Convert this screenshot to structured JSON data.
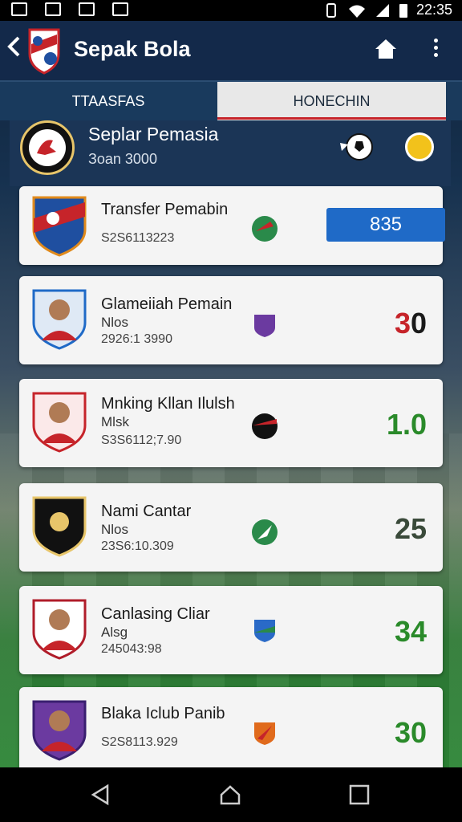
{
  "status_bar": {
    "time": "22:35"
  },
  "app_bar": {
    "title": "Sepak Bola"
  },
  "tabs": [
    {
      "label": "TTAASFAS",
      "active": false
    },
    {
      "label": "HONECHIN",
      "active": true
    }
  ],
  "header": {
    "title": "Seplar Pemasia",
    "subtitle": "Зoan 3000"
  },
  "items": [
    {
      "name": "Transfer Pemabin",
      "sub": "",
      "code": "S2S6113223",
      "score": "835",
      "score_color": "#ffffff",
      "highlight": true
    },
    {
      "name": "Glameiiah Pemain",
      "sub": "Nlos",
      "code": "2926:1 3990",
      "score": "30",
      "score_color": "#1a1a1a",
      "highlight": false
    },
    {
      "name": "Mnking Kllan Ilulsh",
      "sub": "Mlsk",
      "code": "S3S6112;7.90",
      "score": "1.0",
      "score_color": "#2a8a2a",
      "highlight": false
    },
    {
      "name": "Nami Cantar",
      "sub": "Nlos",
      "code": "23S6:10.309",
      "score": "25",
      "score_color": "#3a4a3a",
      "highlight": false
    },
    {
      "name": "Canlasing Cliar",
      "sub": "Alsg",
      "code": "245043:98",
      "score": "34",
      "score_color": "#2a8a2a",
      "highlight": false
    },
    {
      "name": "Blaka Iclub Panib",
      "sub": "",
      "code": "S2S8113.929",
      "score": "30",
      "score_color": "#2a8a2a",
      "highlight": false
    }
  ],
  "colors": {
    "accent_blue": "#1f6ac7",
    "tab_underline": "#c6242a",
    "appbar": "#13294a"
  },
  "icons": [
    "back-arrow-icon",
    "club-logo-icon",
    "home-icon",
    "more-vert-icon",
    "soccer-ball-icon",
    "coin-icon",
    "nav-back-icon",
    "nav-home-icon",
    "nav-recents-icon"
  ]
}
